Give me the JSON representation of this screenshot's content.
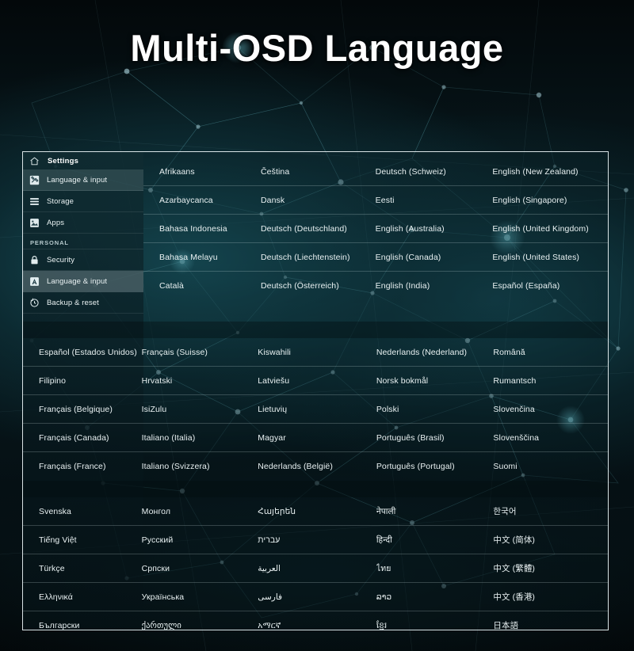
{
  "title": "Multi-OSD Language",
  "panel": {
    "nav": {
      "home_icon": "home-icon",
      "header_title": "Settings",
      "section_label": "PERSONAL",
      "items": [
        {
          "label": "Language & input",
          "icon": "wrench-screwdriver-icon",
          "state": "header-current"
        },
        {
          "label": "Storage",
          "icon": "storage-lines-icon",
          "state": "normal"
        },
        {
          "label": "Apps",
          "icon": "apps-image-icon",
          "state": "normal"
        },
        {
          "label": "Security",
          "icon": "lock-icon",
          "state": "normal"
        },
        {
          "label": "Language & input",
          "icon": "language-a-icon",
          "state": "selected"
        },
        {
          "label": "Backup & reset",
          "icon": "backup-reset-icon",
          "state": "normal"
        }
      ]
    },
    "blocks": [
      {
        "rows": [
          [
            "Afrikaans",
            "Čeština",
            "Deutsch (Schweiz)",
            "English (New Zealand)"
          ],
          [
            "Azarbaycanca",
            "Dansk",
            "Eesti",
            "English (Singapore)"
          ],
          [
            "Bahasa Indonesia",
            "Deutsch (Deutschland)",
            "English (Australia)",
            "English (United Kingdom)"
          ],
          [
            "Bahasa Melayu",
            "Deutsch (Liechtenstein)",
            "English (Canada)",
            "English (United States)"
          ],
          [
            "Català",
            "Deutsch (Österreich)",
            "English (India)",
            "Español (España)"
          ]
        ]
      },
      {
        "rows": [
          [
            "Español (Estados Unidos)",
            "Français (Suisse)",
            "Kiswahili",
            "Nederlands (Nederland)",
            "Română"
          ],
          [
            "Filipino",
            "Hrvatski",
            "Latviešu",
            "Norsk bokmål",
            "Rumantsch"
          ],
          [
            "Français (Belgique)",
            "IsiZulu",
            "Lietuvių",
            "Polski",
            "Slovenčina"
          ],
          [
            "Français (Canada)",
            "Italiano (Italia)",
            "Magyar",
            "Português (Brasil)",
            "Slovenščina"
          ],
          [
            "Français (France)",
            "Italiano (Svizzera)",
            "Nederlands (België)",
            "Português (Portugal)",
            "Suomi"
          ]
        ]
      },
      {
        "rows": [
          [
            "Svenska",
            "Монгол",
            "Հայերեն",
            "नेपाली",
            "한국어"
          ],
          [
            "Tiếng Việt",
            "Русский",
            "עברית",
            "हिन्दी",
            "中文 (简体)"
          ],
          [
            "Türkçe",
            "Српски",
            "العربية",
            "ไทย",
            "中文 (繁體)"
          ],
          [
            "Ελληνικά",
            "Українська",
            "فارسی",
            "ລາວ",
            "中文 (香港)"
          ],
          [
            "Български",
            "ქართული",
            "አማርኛ",
            "ខ្មែរ",
            "日本語"
          ]
        ]
      }
    ]
  },
  "colors": {
    "background": "#040809",
    "panel_border": "#ecf4f6",
    "text": "#e9f1f2",
    "title": "#ffffff",
    "accent_teal": "#1b5c68"
  }
}
